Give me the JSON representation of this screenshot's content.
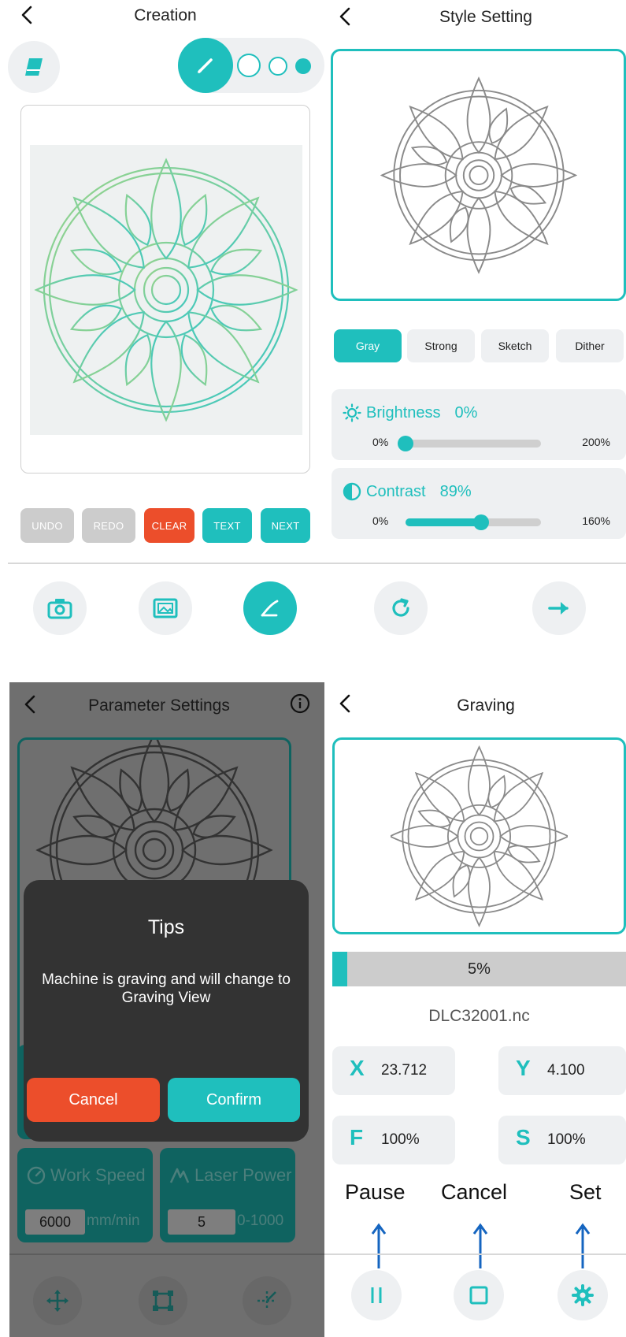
{
  "creation": {
    "title": "Creation",
    "buttons": {
      "undo": "UNDO",
      "redo": "REDO",
      "clear": "CLEAR",
      "text": "TEXT",
      "next": "NEXT"
    }
  },
  "style_setting": {
    "title": "Style Setting",
    "tabs": [
      {
        "label": "Gray",
        "active": true
      },
      {
        "label": "Strong",
        "active": false
      },
      {
        "label": "Sketch",
        "active": false
      },
      {
        "label": "Dither",
        "active": false
      }
    ],
    "brightness": {
      "label": "Brightness",
      "value": "0%",
      "min": "0%",
      "max": "200%",
      "fraction": 0.0
    },
    "contrast": {
      "label": "Contrast",
      "value": "89%",
      "min": "0%",
      "max": "160%",
      "fraction": 0.556
    }
  },
  "parameter_settings": {
    "title": "Parameter Settings",
    "dialog": {
      "title": "Tips",
      "message": "Machine is graving and will change to Graving View",
      "cancel": "Cancel",
      "confirm": "Confirm"
    },
    "work_speed": {
      "label": "Work Speed",
      "value": "6000",
      "unit": "mm/min"
    },
    "laser_power": {
      "label": "Laser Power",
      "value": "5",
      "range": "0-1000"
    }
  },
  "graving": {
    "title": "Graving",
    "progress": {
      "label": "5%",
      "fraction": 0.05
    },
    "filename": "DLC32001.nc",
    "coords": [
      {
        "letter": "X",
        "value": "23.712"
      },
      {
        "letter": "Y",
        "value": "4.100"
      },
      {
        "letter": "F",
        "value": "100%"
      },
      {
        "letter": "S",
        "value": "100%"
      }
    ],
    "actions": {
      "pause": "Pause",
      "cancel": "Cancel",
      "set": "Set"
    }
  },
  "colors": {
    "accent": "#1fbfbd",
    "danger": "#ec4e2b",
    "disabled": "#cccccc",
    "annotation": "#1565c0"
  },
  "icons": [
    "back-icon",
    "eraser-icon",
    "pen-icon",
    "camera-icon",
    "gallery-icon",
    "draw-icon",
    "refresh-icon",
    "arrow-right-icon",
    "info-icon",
    "move-icon",
    "frame-icon",
    "origin-icon",
    "pause-icon",
    "stop-icon",
    "gear-icon"
  ]
}
